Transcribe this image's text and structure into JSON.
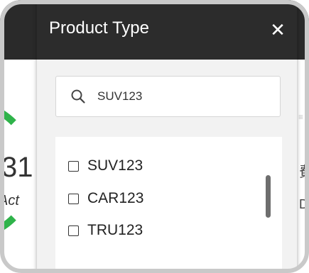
{
  "background": {
    "metric_value": "31",
    "metric_label": "Act",
    "right_glyph_1": "≡",
    "right_glyph_2": "費",
    "right_glyph_3": "D"
  },
  "dropdown": {
    "title": "Product Type",
    "close_icon": "close-icon",
    "search": {
      "icon": "search-icon",
      "value": "SUV123"
    },
    "options": [
      {
        "label": "SUV123",
        "checked": false
      },
      {
        "label": "CAR123",
        "checked": false
      },
      {
        "label": "TRU123",
        "checked": false
      }
    ]
  },
  "colors": {
    "header_bg": "#2c2c2c",
    "panel_bg": "#f2f2f2",
    "accent_green": "#2fb34a"
  }
}
